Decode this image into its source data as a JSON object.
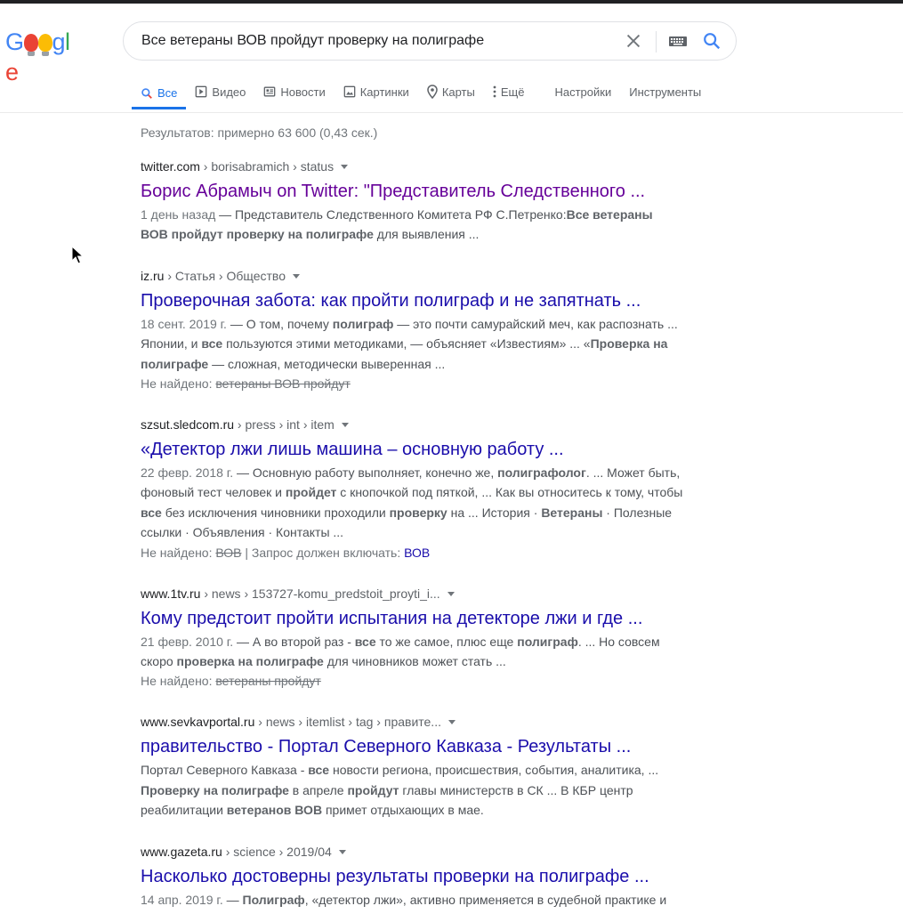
{
  "search": {
    "query": "Все ветераны ВОВ пройдут проверку на полиграфе"
  },
  "logo": {
    "text": "Google"
  },
  "tabs": [
    {
      "label": "Все",
      "icon": "search-icon"
    },
    {
      "label": "Видео",
      "icon": "play-icon"
    },
    {
      "label": "Новости",
      "icon": "news-icon"
    },
    {
      "label": "Картинки",
      "icon": "image-icon"
    },
    {
      "label": "Карты",
      "icon": "map-pin-icon"
    },
    {
      "label": "Ещё",
      "icon": "more-vertical-icon"
    },
    {
      "label": "Настройки"
    },
    {
      "label": "Инструменты"
    }
  ],
  "stats": "Результатов: примерно 63 600 (0,43 сек.)",
  "results": [
    {
      "domain": "twitter.com",
      "path": " › borisabramich › status",
      "title": "Борис Абрамыч on Twitter: \"Представитель Следственного ...",
      "date": "1 день назад",
      "snippet_1": " — Представитель Следственного Комитета РФ С.Петренко:",
      "snippet_b1": "Все ветераны ВОВ пройдут проверку на полиграфе",
      "snippet_2": " для выявления ..."
    },
    {
      "domain": "iz.ru",
      "path": " › Статья › Общество",
      "title": "Проверочная забота: как пройти полиграф и не запятнать ...",
      "date": "18 сент. 2019 г.",
      "snippet_1": " — О том, почему ",
      "snippet_b1": "полиграф",
      "snippet_2": " — это почти самурайский меч, как распознать ... Японии, и ",
      "snippet_b2": "все",
      "snippet_3": " пользуются этими методиками, — объясняет «Известиям» ... «",
      "snippet_b3": "Проверка на полиграфе",
      "snippet_4": " — сложная, методически выверенная ...",
      "missing_label": "Не найдено: ",
      "missing_terms": "ветераны ВОВ пройдут"
    },
    {
      "domain": "szsut.sledcom.ru",
      "path": " › press › int › item",
      "title": "«Детектор лжи лишь машина – основную работу ...",
      "date": "22 февр. 2018 г.",
      "snippet_1": " — Основную работу выполняет, конечно же, ",
      "snippet_b1": "полиграфолог",
      "snippet_2": ". ... Может быть, фоновый тест человек и ",
      "snippet_b2": "пройдет",
      "snippet_3": " с кнопочкой под пяткой, ... Как вы относитесь к тому, чтобы ",
      "snippet_b3": "все",
      "snippet_4": " без исключения чиновники проходили ",
      "snippet_b4": "проверку",
      "snippet_5": " на ... История · ",
      "snippet_b5": "Ветераны",
      "snippet_6": " · Полезные ссылки · Объявления · Контакты ...",
      "missing_label": "Не найдено: ",
      "missing_terms": "ВОВ",
      "must_include_label": " | Запрос должен включать: ",
      "must_include_link": "ВОВ"
    },
    {
      "domain": "www.1tv.ru",
      "path": " › news › 153727-komu_predstoit_proyti_i...",
      "title": "Кому предстоит пройти испытания на детекторе лжи и где ...",
      "date": "21 февр. 2010 г.",
      "snippet_1": " — А во второй раз - ",
      "snippet_b1": "все",
      "snippet_2": " то же самое, плюс еще ",
      "snippet_b2": "полиграф",
      "snippet_3": ". ... Но совсем скоро ",
      "snippet_b3": "проверка на полиграфе",
      "snippet_4": " для чиновников может стать ...",
      "missing_label": "Не найдено: ",
      "missing_terms": "ветераны пройдут"
    },
    {
      "domain": "www.sevkavportal.ru",
      "path": " › news › itemlist › tag › правите...",
      "title": "правительство - Портал Северного Кавказа - Результаты ...",
      "snippet_1": "Портал Северного Кавказа - ",
      "snippet_b1": "все",
      "snippet_2": " новости региона, происшествия, события, аналитика, ... ",
      "snippet_b2": "Проверку на полиграфе",
      "snippet_3": " в апреле ",
      "snippet_b3": "пройдут",
      "snippet_4": " главы министерств в СК ... В КБР центр реабилитации ",
      "snippet_b4": "ветеранов ВОВ",
      "snippet_5": " примет отдыхающих в мае."
    },
    {
      "domain": "www.gazeta.ru",
      "path": " › science › 2019/04",
      "title": "Насколько достоверны результаты проверки на полиграфе ...",
      "date": "14 апр. 2019 г.",
      "snippet_1": " — ",
      "snippet_b1": "Полиграф",
      "snippet_2": ", «детектор лжи», активно применяется в судебной практике и"
    }
  ]
}
